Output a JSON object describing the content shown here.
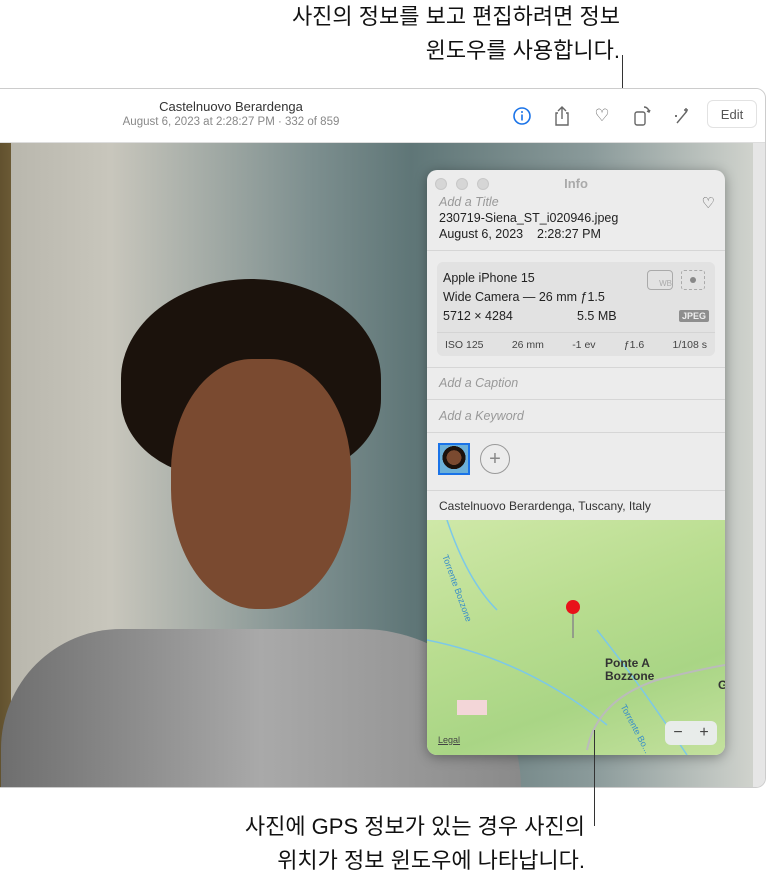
{
  "callouts": {
    "top_line1": "사진의 정보를 보고 편집하려면 정보",
    "top_line2": "윈도우를 사용합니다.",
    "bottom_line1": "사진에 GPS 정보가 있는 경우 사진의",
    "bottom_line2": "위치가 정보 윈도우에 나타납니다."
  },
  "toolbar": {
    "title": "Castelnuovo Berardenga",
    "subtitle": "August 6, 2023 at 2:28:27 PM  ·  332 of 859",
    "edit_label": "Edit",
    "accent": "#1a73e8"
  },
  "info": {
    "window_title": "Info",
    "title_placeholder": "Add a Title",
    "filename": "230719-Siena_ST_i020946.jpeg",
    "datetime": "August 6, 2023    2:28:27 PM",
    "camera": "Apple iPhone 15",
    "lens": "Wide Camera — 26 mm ƒ1.5",
    "dimensions": "5712 × 4284",
    "size": "5.5 MB",
    "format": "JPEG",
    "wb": "WB",
    "exif": [
      "ISO 125",
      "26 mm",
      "-1 ev",
      "ƒ1.6",
      "1/108 s"
    ],
    "caption_placeholder": "Add a Caption",
    "keyword_placeholder": "Add a Keyword",
    "location": "Castelnuovo Berardenga, Tuscany, Italy"
  },
  "map": {
    "place_line1": "Ponte A",
    "place_line2": "Bozzone",
    "river1": "Torrente Bozzone",
    "river2": "Torrente Bo...",
    "legal": "Legal",
    "edge": "G",
    "zoom_out": "−",
    "zoom_in": "+"
  }
}
